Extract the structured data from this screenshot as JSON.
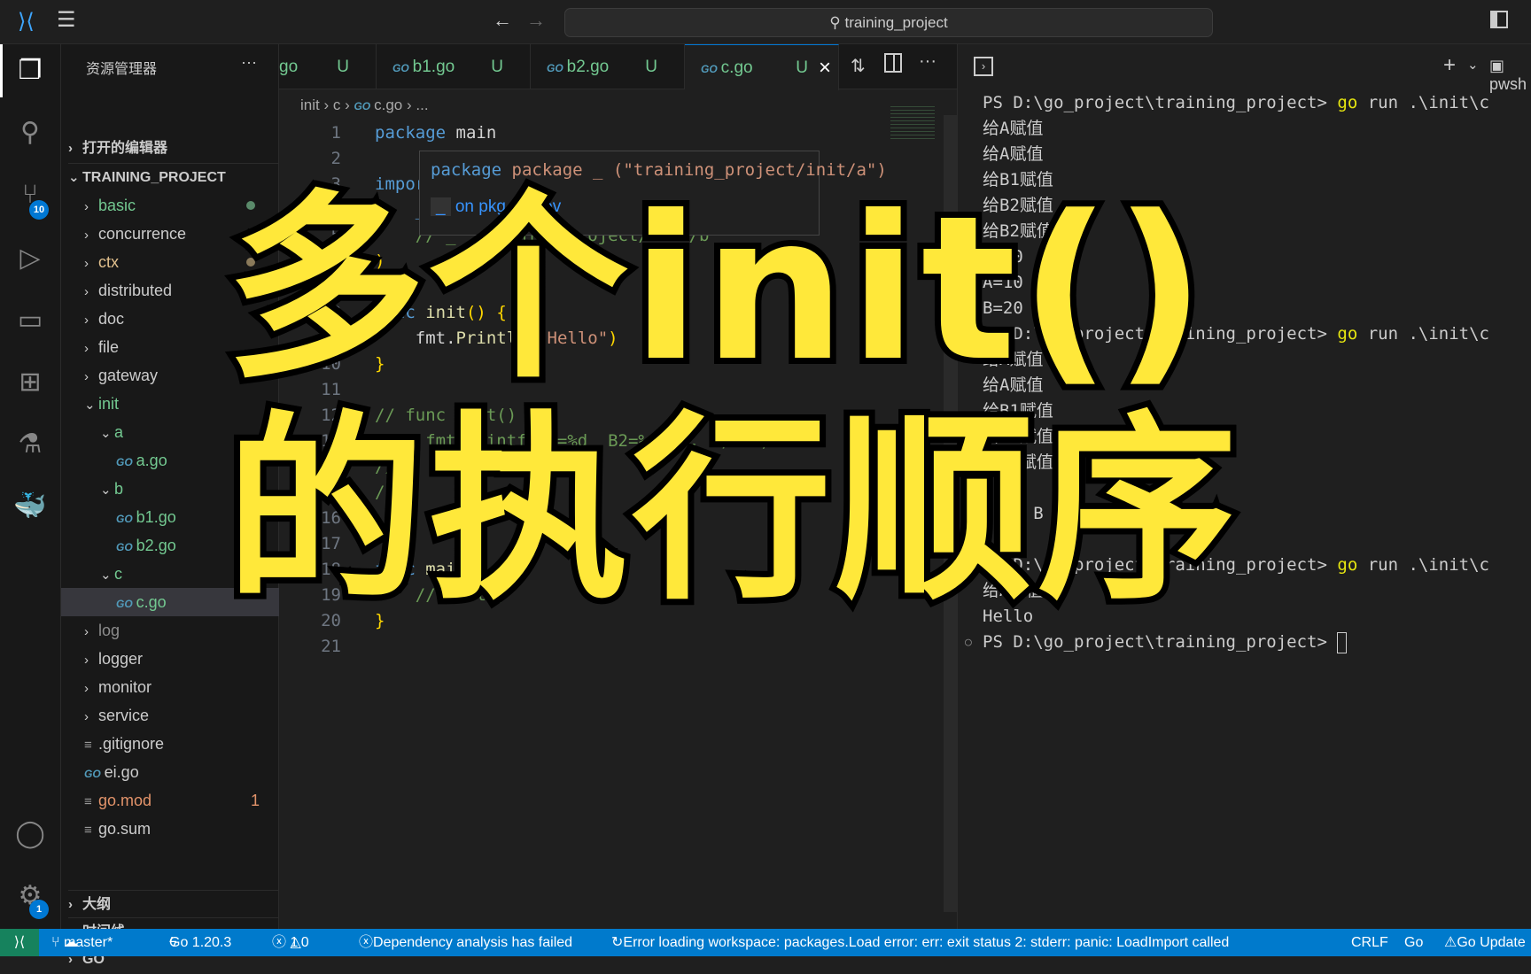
{
  "titlebar": {
    "search": "training_project"
  },
  "activity": {
    "scm_badge": "10",
    "settings_badge": "1"
  },
  "sidebar": {
    "title": "资源管理器",
    "more": "···",
    "open_editors": "打开的编辑器",
    "project": "TRAINING_PROJECT",
    "items": [
      {
        "label": "basic",
        "color": "#73c991",
        "dot": "#5a8a6a"
      },
      {
        "label": "concurrence",
        "color": "#cccccc"
      },
      {
        "label": "ctx",
        "color": "#e2c08d",
        "dot": "#8a7a5a"
      },
      {
        "label": "distributed",
        "color": "#cccccc"
      },
      {
        "label": "doc",
        "color": "#cccccc"
      },
      {
        "label": "file",
        "color": "#cccccc"
      },
      {
        "label": "gateway",
        "color": "#cccccc"
      },
      {
        "label": "init",
        "color": "#73c991"
      },
      {
        "label": "a",
        "color": "#73c991"
      },
      {
        "label": "a.go",
        "color": "#73c991"
      },
      {
        "label": "b",
        "color": "#73c991"
      },
      {
        "label": "b1.go",
        "color": "#73c991"
      },
      {
        "label": "b2.go",
        "color": "#73c991"
      },
      {
        "label": "c",
        "color": "#73c991"
      },
      {
        "label": "c.go",
        "color": "#73c991"
      },
      {
        "label": "log",
        "color": "#8c8c8c"
      },
      {
        "label": "logger",
        "color": "#cccccc"
      },
      {
        "label": "monitor",
        "color": "#cccccc"
      },
      {
        "label": "service",
        "color": "#cccccc"
      },
      {
        "label": ".gitignore",
        "color": "#cccccc"
      },
      {
        "label": "ei.go",
        "color": "#cccccc"
      },
      {
        "label": "go.mod",
        "color": "#e2936a",
        "badge": "1"
      },
      {
        "label": "go.sum",
        "color": "#cccccc"
      }
    ],
    "outline": "大纲",
    "timeline": "时间线",
    "go": "GO"
  },
  "editor": {
    "tabs": [
      {
        "label": "go",
        "status": "U"
      },
      {
        "label": "b1.go",
        "status": "U"
      },
      {
        "label": "b2.go",
        "status": "U"
      },
      {
        "label": "c.go",
        "status": "U",
        "active": true
      }
    ],
    "close": "×",
    "breadcrumb": [
      "init",
      "c",
      "c.go",
      "..."
    ],
    "hover": {
      "signature": "package _ (\"training_project/init/a\")",
      "link": "on pkg.go.dev"
    },
    "lines": [
      {
        "n": "1",
        "html": "<span class='kw'>package</span> <span class='id'>main</span>"
      },
      {
        "n": "2",
        "html": ""
      },
      {
        "n": "3",
        "html": "<span class='kw'>import</span> <span class='br'>(</span>"
      },
      {
        "n": "4",
        "html": "    <span class='kw'>_</span> <span class='str'>\"training_project/init/a\"</span>"
      },
      {
        "n": "5",
        "html": "    <span class='cm'>// _ \"training_project/init/b\"</span>"
      },
      {
        "n": "6",
        "html": "<span class='br'>)</span>"
      },
      {
        "n": "7",
        "html": ""
      },
      {
        "n": "8",
        "html": "<span class='kw'>func</span> <span class='fn'>init</span><span class='br'>()</span> <span class='br'>{</span>"
      },
      {
        "n": "9",
        "html": "    <span class='id'>fmt.</span><span class='fn'>Println</span><span class='br'>(</span><span class='str'>\"Hello\"</span><span class='br'>)</span>"
      },
      {
        "n": "10",
        "html": "<span class='br'>}</span>"
      },
      {
        "n": "11",
        "html": ""
      },
      {
        "n": "12",
        "html": "<span class='cm'>// func Init() {</span>"
      },
      {
        "n": "13",
        "html": "<span class='cm'>//   fmt.Printf(\"A=%d  B2=%d\\n\", a, b2)</span>"
      },
      {
        "n": "14",
        "html": "<span class='cm'>//   ...\",</span>"
      },
      {
        "n": "15",
        "html": "<span class='cm'>// }</span>"
      },
      {
        "n": "16",
        "html": ""
      },
      {
        "n": "17",
        "html": ""
      },
      {
        "n": "18",
        "html": "<span class='kw'>func</span> <span class='fn'>main</span><span class='br'>()</span> <span class='br'>{</span>"
      },
      {
        "n": "19",
        "html": "    <span class='cm'>// Init()</span>"
      },
      {
        "n": "20",
        "html": "<span class='br'>}</span>"
      },
      {
        "n": "21",
        "html": ""
      }
    ]
  },
  "terminal": {
    "shell": "pwsh",
    "lines": [
      {
        "t": "PS D:\\go_project\\training_project> ",
        "g": "go",
        "r": " run .\\init\\c"
      },
      {
        "t": "给A赋值"
      },
      {
        "t": "给A赋值"
      },
      {
        "t": "给B1赋值"
      },
      {
        "t": "给B2赋值"
      },
      {
        "t": "给B2赋值"
      },
      {
        "t": "A=10"
      },
      {
        "t": "A=10  B2"
      },
      {
        "t": "B=20"
      },
      {
        "t": "PS D:\\go_project\\training_project> ",
        "g": "go",
        "r": " run .\\init\\c"
      },
      {
        "t": "给A赋值"
      },
      {
        "t": "给A赋值"
      },
      {
        "t": "给B1赋值"
      },
      {
        "t": "给B2赋值"
      },
      {
        "t": "给B2赋值"
      },
      {
        "t": ""
      },
      {
        "t": "     B"
      },
      {
        "t": ""
      },
      {
        "t": "PS D:\\go_project\\training_project> ",
        "g": "go",
        "r": " run .\\init\\c"
      },
      {
        "t": "给A赋值"
      },
      {
        "t": "Hello"
      },
      {
        "t": "PS D:\\go_project\\training_project> "
      }
    ]
  },
  "statusbar": {
    "branch": "master*",
    "go_version": "Go 1.20.3",
    "errors": "1",
    "warnings": "0",
    "dep": "Dependency analysis has failed",
    "workspace": "Error loading workspace: packages.Load error: err: exit status 2: stderr: panic: LoadImport called",
    "eol": "CRLF",
    "lang": "Go",
    "update": "Go Update"
  },
  "overlay": {
    "line1": "多个init()",
    "line2": "的执行顺序",
    "color": "#ffe83a"
  }
}
